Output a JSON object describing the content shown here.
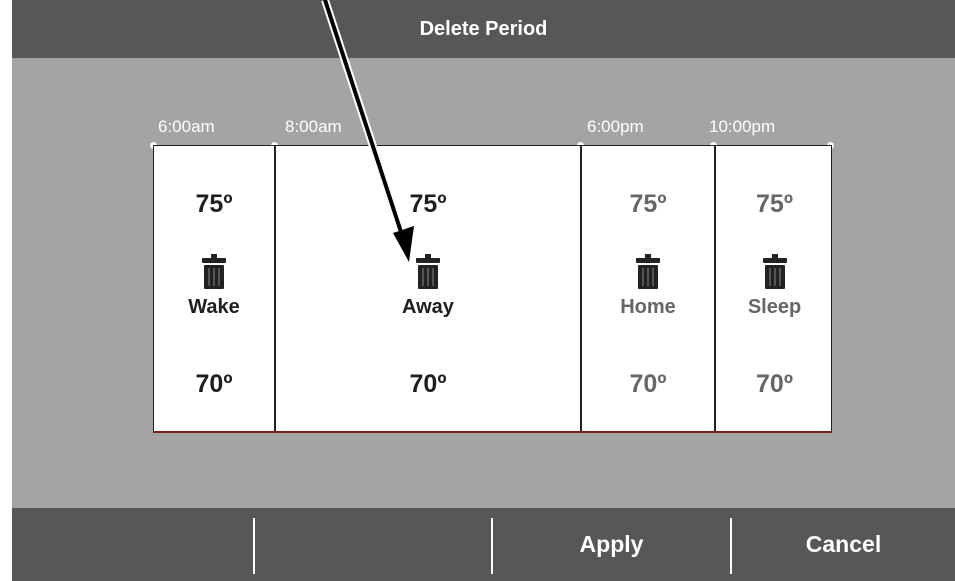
{
  "title": "Delete Period",
  "times": [
    "6:00am",
    "8:00am",
    "6:00pm",
    "10:00pm"
  ],
  "periods": [
    {
      "name": "Wake",
      "heat": "75º",
      "cool": "70º"
    },
    {
      "name": "Away",
      "heat": "75º",
      "cool": "70º"
    },
    {
      "name": "Home",
      "heat": "75º",
      "cool": "70º"
    },
    {
      "name": "Sleep",
      "heat": "75º",
      "cool": "70º"
    }
  ],
  "buttons": {
    "apply": "Apply",
    "cancel": "Cancel"
  },
  "icons": {
    "delete": "trash-icon"
  },
  "colors": {
    "background": "#a4a4a4",
    "bar": "#575757",
    "active_text": "#1e1e1e",
    "inactive_text": "#666666"
  }
}
